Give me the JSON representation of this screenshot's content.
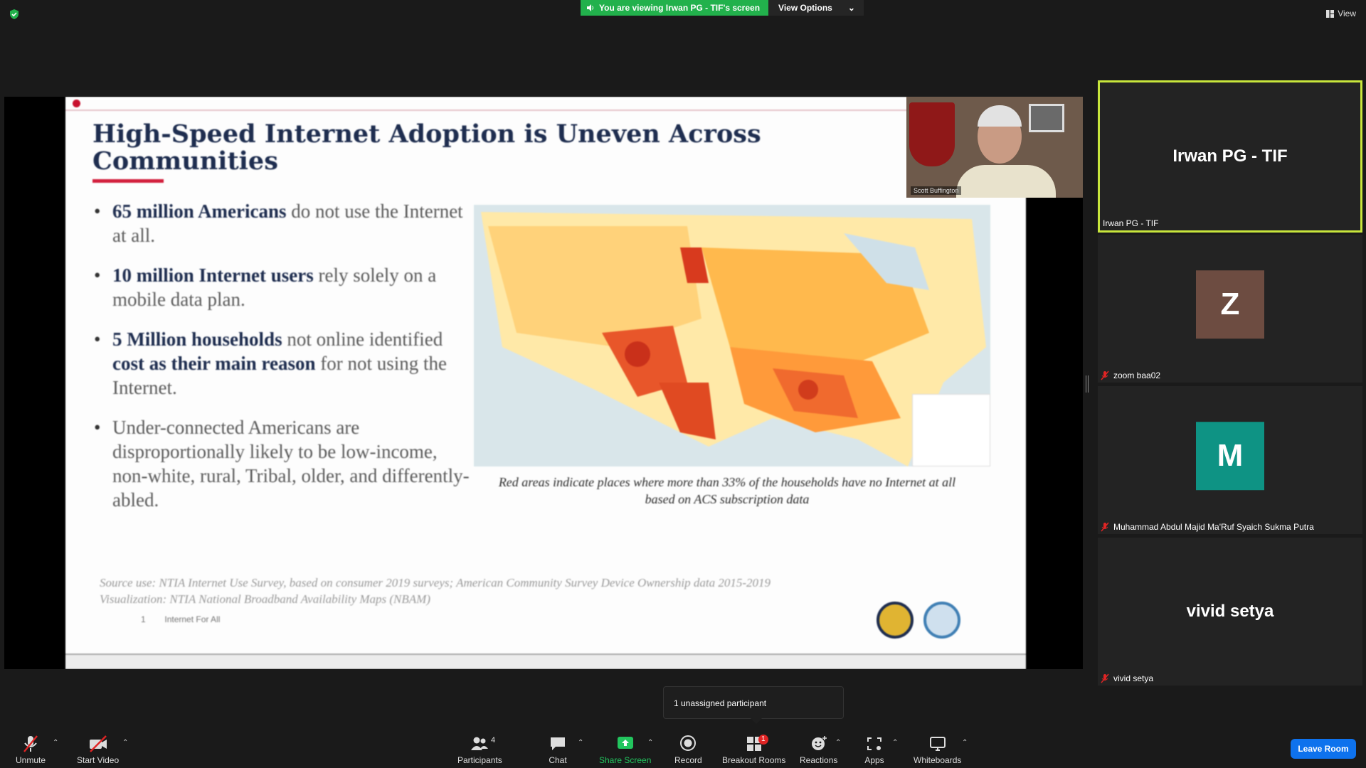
{
  "top_bar": {
    "share_banner": "You are viewing Irwan PG - TIF's screen",
    "view_options_label": "View Options",
    "view_label": "View"
  },
  "slide": {
    "title": "High-Speed Internet Adoption is Uneven Across Communities",
    "bullets": [
      {
        "bold": "65 million Americans",
        "rest": " do not use the Internet at all."
      },
      {
        "bold": "10 million Internet users",
        "rest": " rely solely on a mobile data plan."
      },
      {
        "bold": "5 Million households",
        "rest": " not online identified ",
        "bold2": "cost as their main reason",
        "rest2": " for not using the Internet."
      },
      {
        "bold": "",
        "rest": "Under-connected Americans are disproportionally likely to be low-income, non-white, rural, Tribal, older, and differently-abled."
      }
    ],
    "map_caption": "Red areas indicate places where more than 33% of the households have no Internet at all based on ACS subscription data",
    "source_line1": "Source use: NTIA Internet Use Survey, based on consumer 2019 surveys; American Community Survey Device Ownership data 2015-2019",
    "source_line2": "Visualization: NTIA National Broadband Availability Maps (NBAM)",
    "page_number": "1",
    "footer_text": "Internet For All",
    "speaker_name_tag": "Scott Buffington"
  },
  "participants": [
    {
      "name": "Irwan PG - TIF",
      "label": "Irwan PG - TIF",
      "display": "name",
      "active": true,
      "muted": false
    },
    {
      "name": "zoom baa02",
      "label": "zoom baa02",
      "display": "avatar",
      "initial": "Z",
      "avatar_color": "#6d4c41",
      "muted": true
    },
    {
      "name": "Muhammad Abdul Majid Ma'Ruf Syaich Sukma Putra",
      "label": "Muhammad Abdul Majid Ma'Ruf Syaich Sukma Putra",
      "display": "avatar",
      "initial": "M",
      "avatar_color": "#0e9384",
      "muted": true
    },
    {
      "name": "vivid setya",
      "label": "vivid setya",
      "display": "name",
      "muted": true
    }
  ],
  "tooltip": "1 unassigned participant",
  "toolbar": {
    "unmute": "Unmute",
    "start_video": "Start Video",
    "participants": "Participants",
    "participants_count": "4",
    "chat": "Chat",
    "share_screen": "Share Screen",
    "record": "Record",
    "breakout_rooms": "Breakout Rooms",
    "breakout_badge": "1",
    "reactions": "Reactions",
    "apps": "Apps",
    "whiteboards": "Whiteboards",
    "leave": "Leave Room"
  },
  "colors": {
    "share_green": "#22b14c",
    "active_border": "#c8e63c",
    "leave_blue": "#0e72ed",
    "slide_title": "#1e2d4f",
    "accent_red": "#d21f3c"
  }
}
